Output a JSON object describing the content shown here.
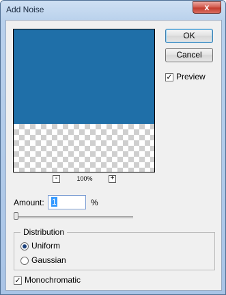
{
  "window": {
    "title": "Add Noise",
    "close_glyph": "x"
  },
  "preview": {
    "zoom_level": "100%",
    "zoom_out": "-",
    "zoom_in": "+"
  },
  "buttons": {
    "ok": "OK",
    "cancel": "Cancel"
  },
  "preview_toggle": {
    "label": "Preview",
    "checked": true
  },
  "amount": {
    "label": "Amount:",
    "value": "1",
    "unit": "%",
    "slider_fraction": 0.0
  },
  "distribution": {
    "legend": "Distribution",
    "options": [
      {
        "label": "Uniform",
        "selected": true
      },
      {
        "label": "Gaussian",
        "selected": false
      }
    ]
  },
  "monochromatic": {
    "label": "Monochromatic",
    "checked": true
  },
  "colors": {
    "preview_fill": "#1f6fa8"
  }
}
